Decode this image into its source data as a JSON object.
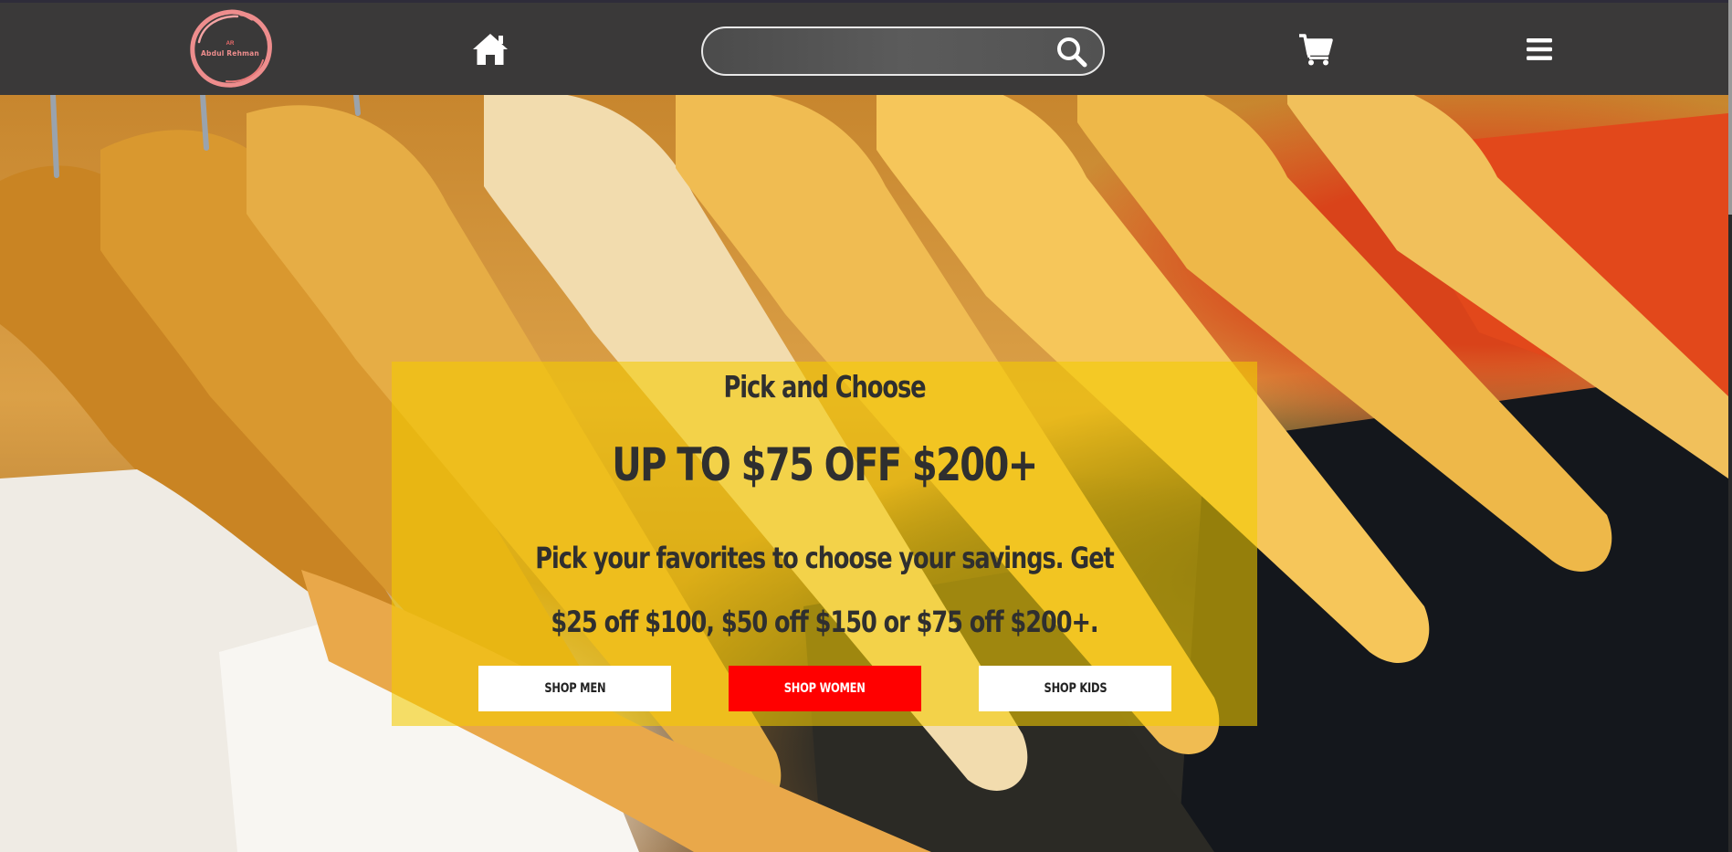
{
  "header": {
    "logo": {
      "name": "Abdul Rehman",
      "mark": "AR",
      "ring_color": "#ee8d8d"
    },
    "icons": {
      "home": "home-icon",
      "search": "search-icon",
      "cart": "cart-icon",
      "menu": "hamburger-menu-icon"
    },
    "search": {
      "value": "",
      "placeholder": ""
    }
  },
  "hero": {
    "background": "clothes-on-wooden-hangers-photo",
    "promo": {
      "kicker": "Pick and Choose",
      "headline": "UP TO $75 OFF $200+",
      "body": "Pick your favorites to choose your savings. Get $25 off $100, $50 off $150 or $75 off $200+.",
      "buttons": [
        {
          "label": "SHOP MEN",
          "bg": "#ffffff"
        },
        {
          "label": "SHOP WOMEN",
          "bg": "#ff0000"
        },
        {
          "label": "SHOP KIDS",
          "bg": "#ffffff"
        }
      ]
    }
  },
  "colors": {
    "navbar": "#3a3939",
    "promo_overlay": "#f3cb00",
    "accent": "#ff0000"
  }
}
